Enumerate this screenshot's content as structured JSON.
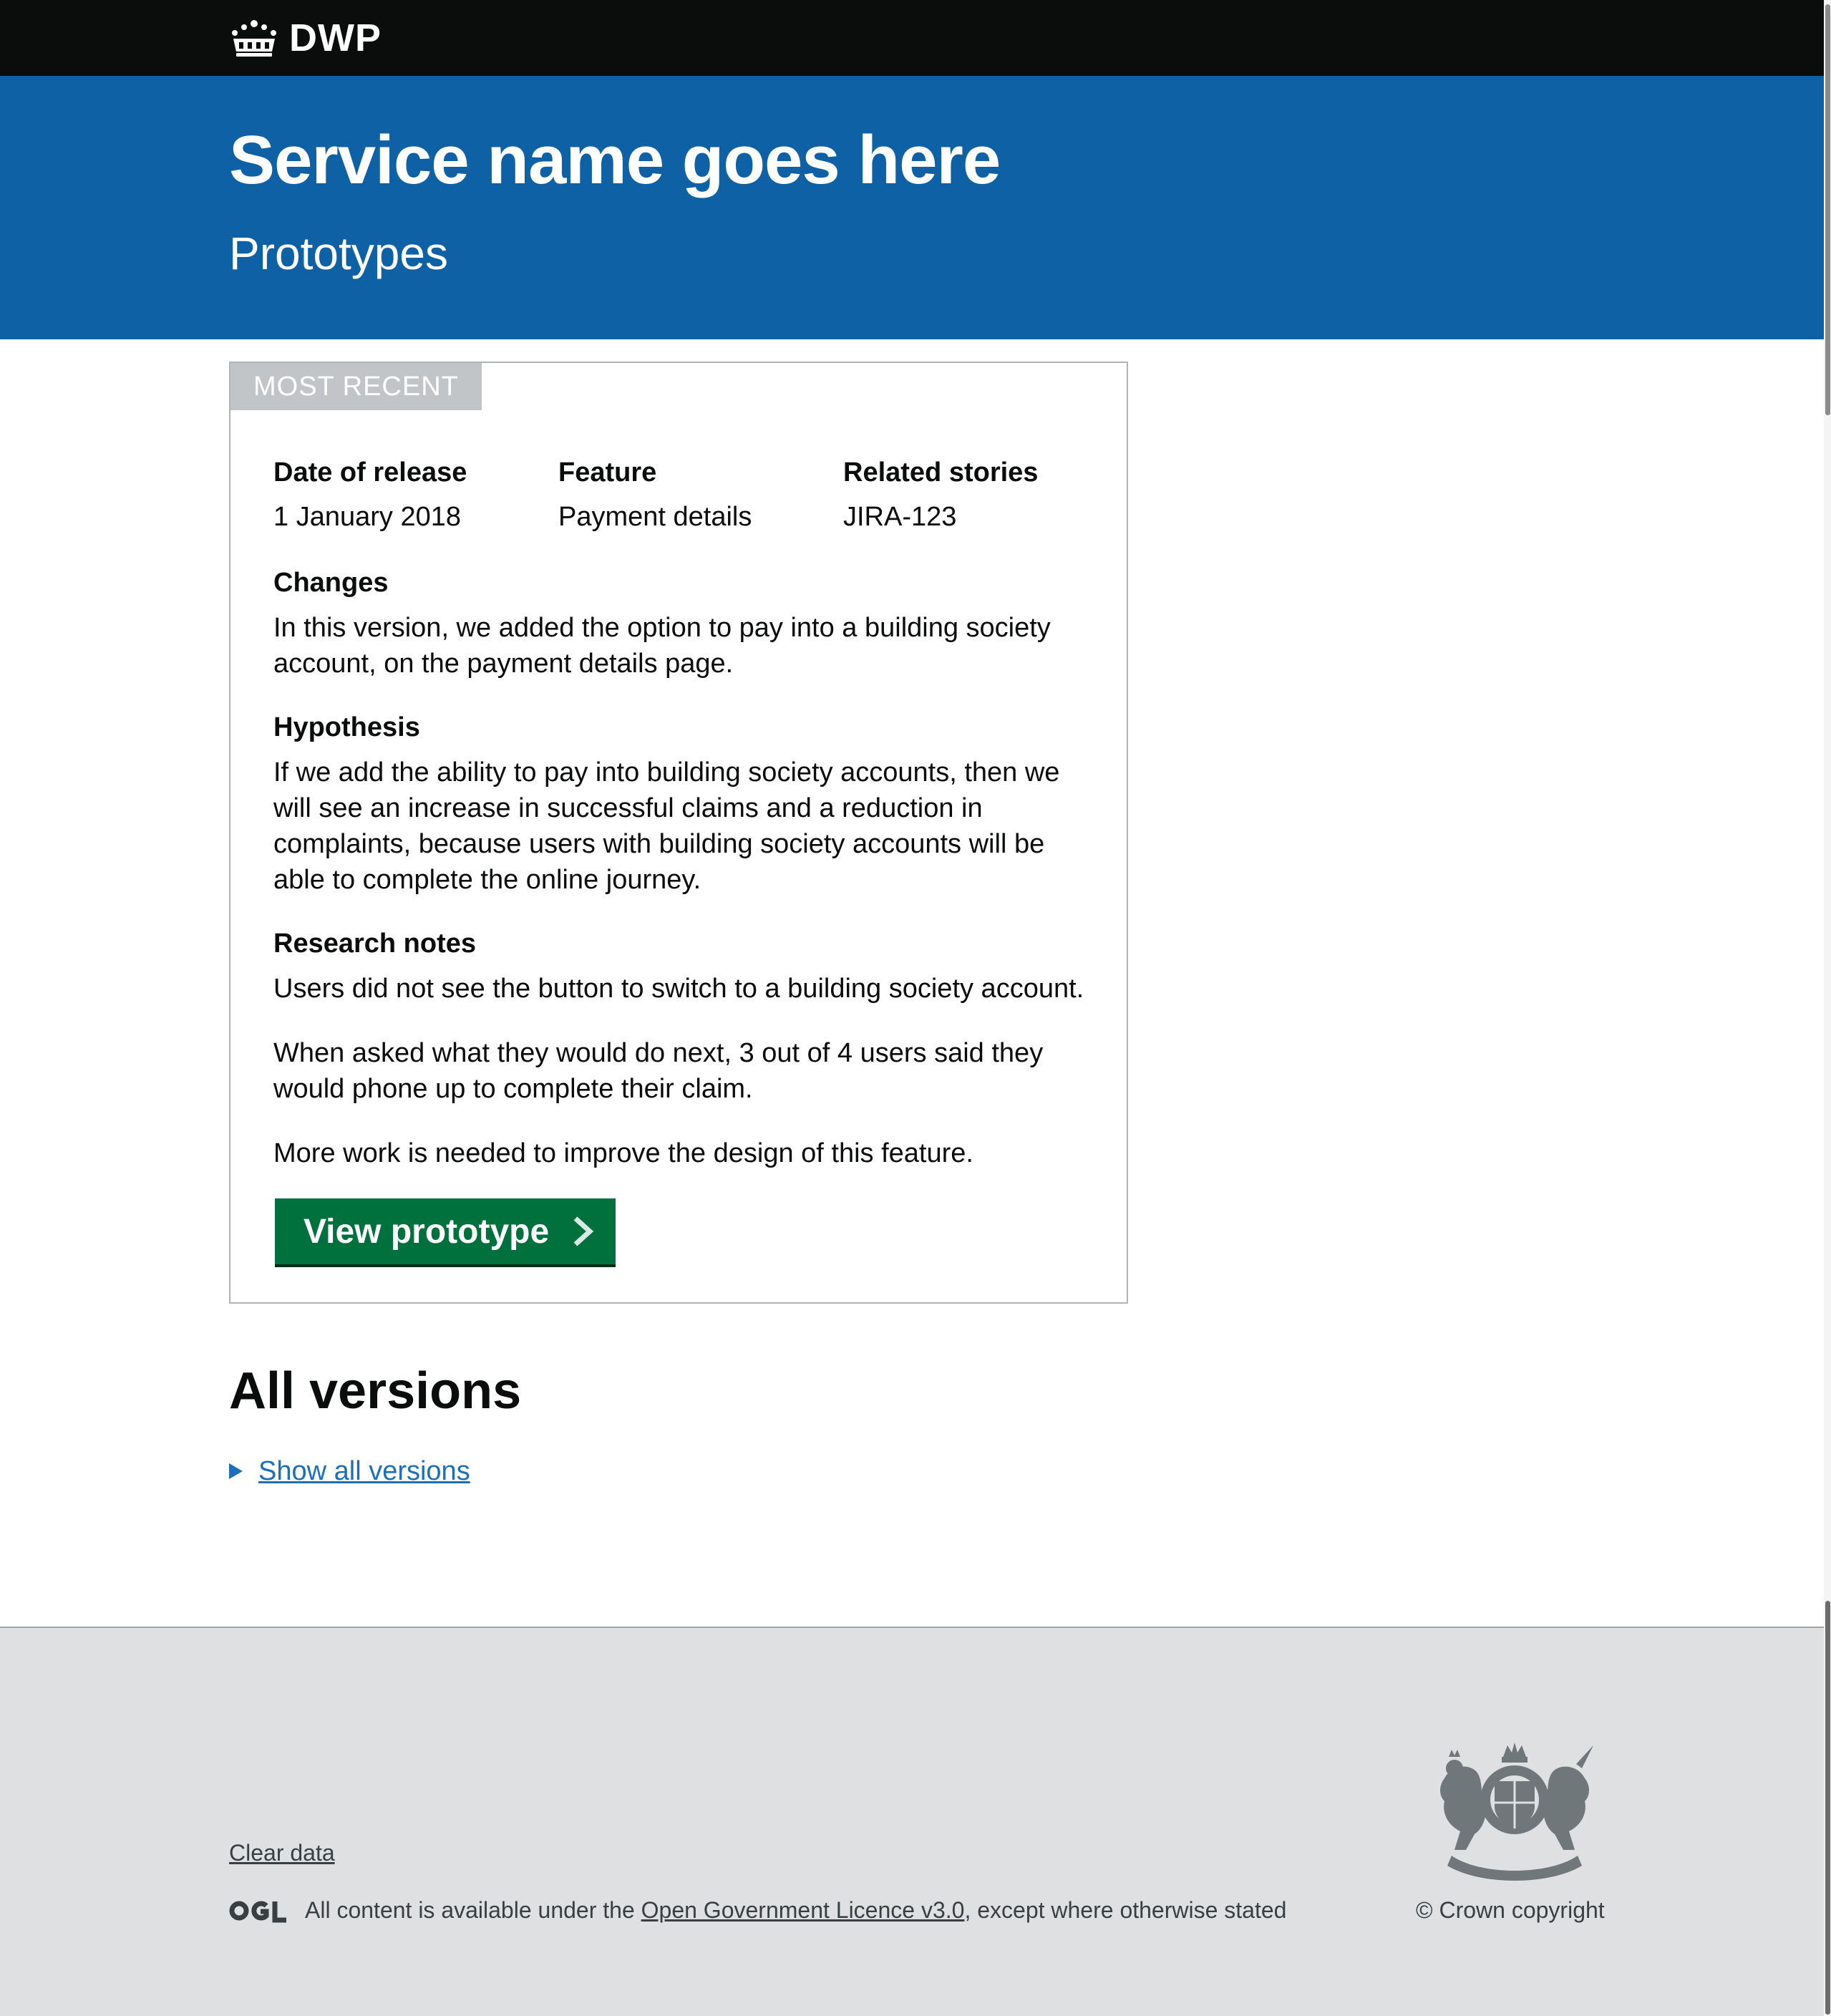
{
  "header": {
    "logo_text": "DWP",
    "logo_icon": "crown-icon"
  },
  "hero": {
    "title": "Service name goes here",
    "subtitle": "Prototypes"
  },
  "most_recent": {
    "tag": "MOST RECENT",
    "meta": [
      {
        "label": "Date of release",
        "value": "1 January 2018"
      },
      {
        "label": "Feature",
        "value": "Payment details"
      },
      {
        "label": "Related stories",
        "value": "JIRA-123"
      }
    ],
    "changes": {
      "heading": "Changes",
      "text": "In this version, we added the option to pay into a building society account, on the payment details page."
    },
    "hypothesis": {
      "heading": "Hypothesis",
      "text": "If we add the ability to pay into building society accounts, then we will see an increase in successful claims and a reduction in complaints, because users with building society accounts will be able to complete the online journey."
    },
    "research": {
      "heading": "Research notes",
      "paragraphs": [
        "Users did not see the button to switch to a building society account.",
        "When asked what they would do next, 3 out of 4 users said they would phone up to complete their claim.",
        "More work is needed to improve the design of this feature."
      ]
    },
    "button_label": "View prototype"
  },
  "all_versions": {
    "heading": "All versions",
    "toggle_label": "Show all versions"
  },
  "footer": {
    "clear_data": "Clear data",
    "licence_prefix": "All content is available under the ",
    "licence_link": "Open Government Licence v3.0",
    "licence_suffix": ", except where otherwise stated",
    "copyright": "© Crown copyright",
    "ogl_logo": "OGL",
    "crest_icon": "royal-coat-of-arms-icon"
  },
  "colors": {
    "header_bg": "#0b0c0c",
    "hero_bg": "#0f61a6",
    "button_bg": "#00703c",
    "link": "#1d70b8",
    "footer_bg": "#dfe0e2"
  }
}
